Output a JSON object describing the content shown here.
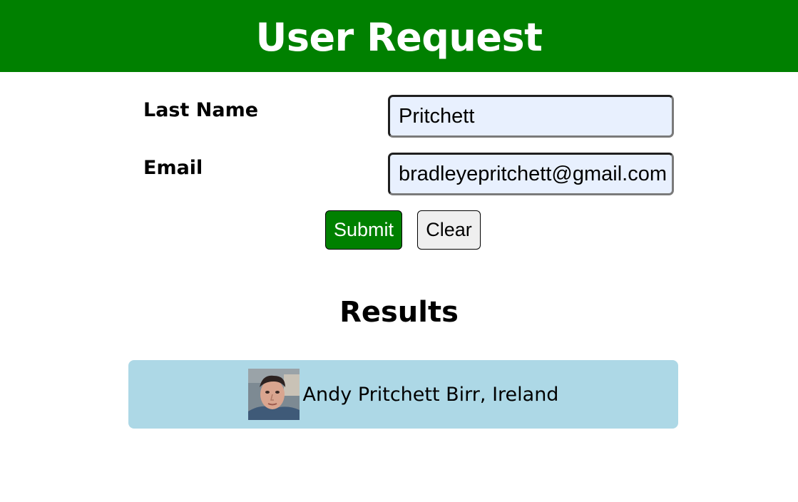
{
  "header": {
    "title": "User Request"
  },
  "form": {
    "last_name": {
      "label": "Last Name",
      "value": "Pritchett"
    },
    "email": {
      "label": "Email",
      "value": "bradleyepritchett@gmail.com"
    },
    "submit_label": "Submit",
    "clear_label": "Clear"
  },
  "results": {
    "title": "Results",
    "items": [
      {
        "text": "Andy Pritchett Birr, Ireland",
        "avatar_icon": "user-photo"
      }
    ]
  },
  "colors": {
    "header_bg": "#008000",
    "submit_bg": "#008000",
    "result_bg": "#add8e6",
    "input_bg": "#e8f0fe"
  }
}
